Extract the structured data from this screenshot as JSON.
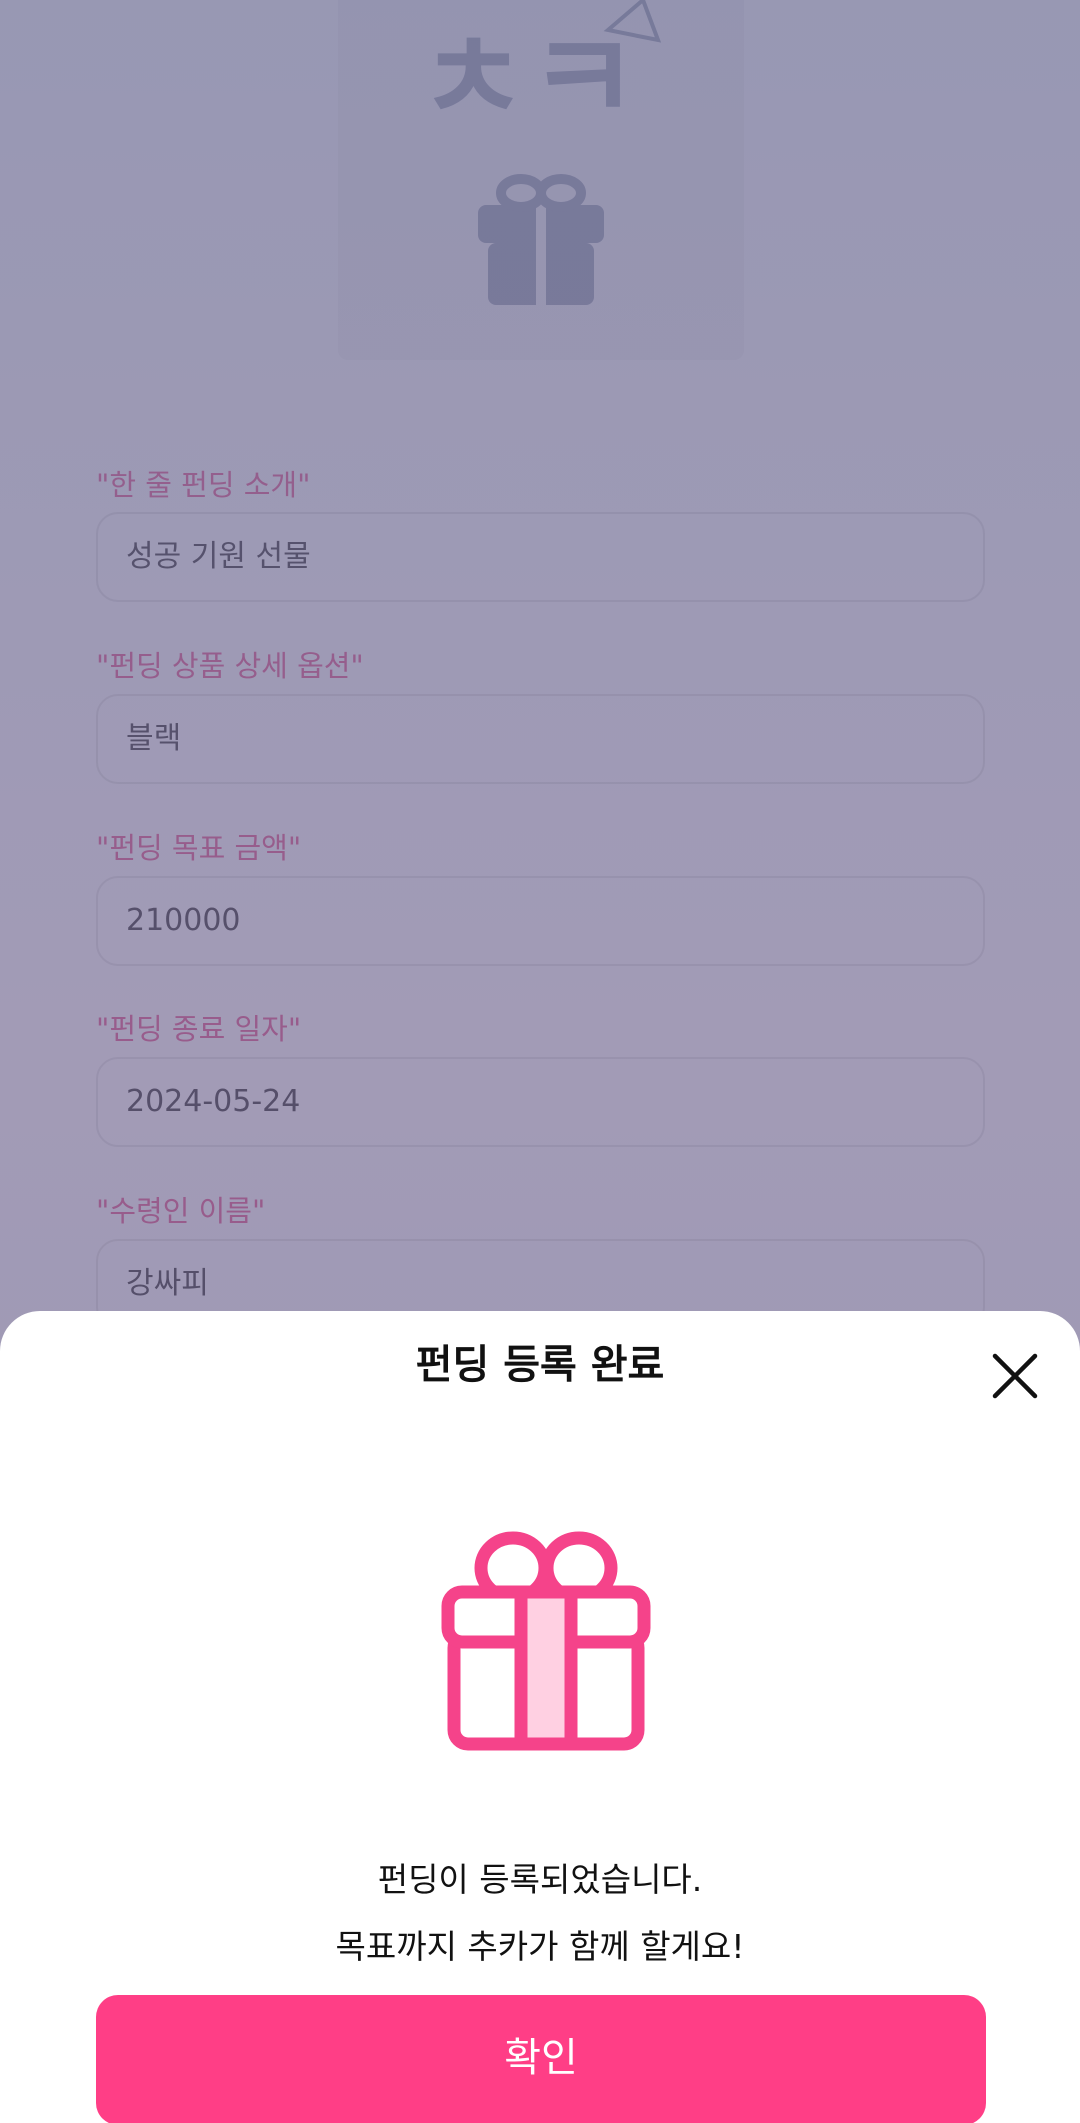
{
  "form": {
    "fields": [
      {
        "label": "\"한 줄 펀딩 소개\"",
        "value": "성공 기원 선물"
      },
      {
        "label": "\"펀딩 상품 상세 옵션\"",
        "value": "블랙"
      },
      {
        "label": "\"펀딩 목표 금액\"",
        "value": "210000"
      },
      {
        "label": "\"펀딩 종료 일자\"",
        "value": "2024-05-24"
      },
      {
        "label": "\"수령인 이름\"",
        "value": "강싸피"
      }
    ],
    "thumbnail_text": "ㅊㅋ"
  },
  "modal": {
    "title": "펀딩 등록 완료",
    "message_line1": "펀딩이 등록되었습니다.",
    "message_line2": "목표까지 추카가 함께 할게요!",
    "confirm_label": "확인",
    "icons": {
      "close": "close-icon",
      "gift": "gift-icon"
    }
  },
  "colors": {
    "accent": "#ff3e86",
    "label": "#e23b7a",
    "gift_stroke": "#f5438a",
    "gift_fill": "#ffd0e2"
  }
}
